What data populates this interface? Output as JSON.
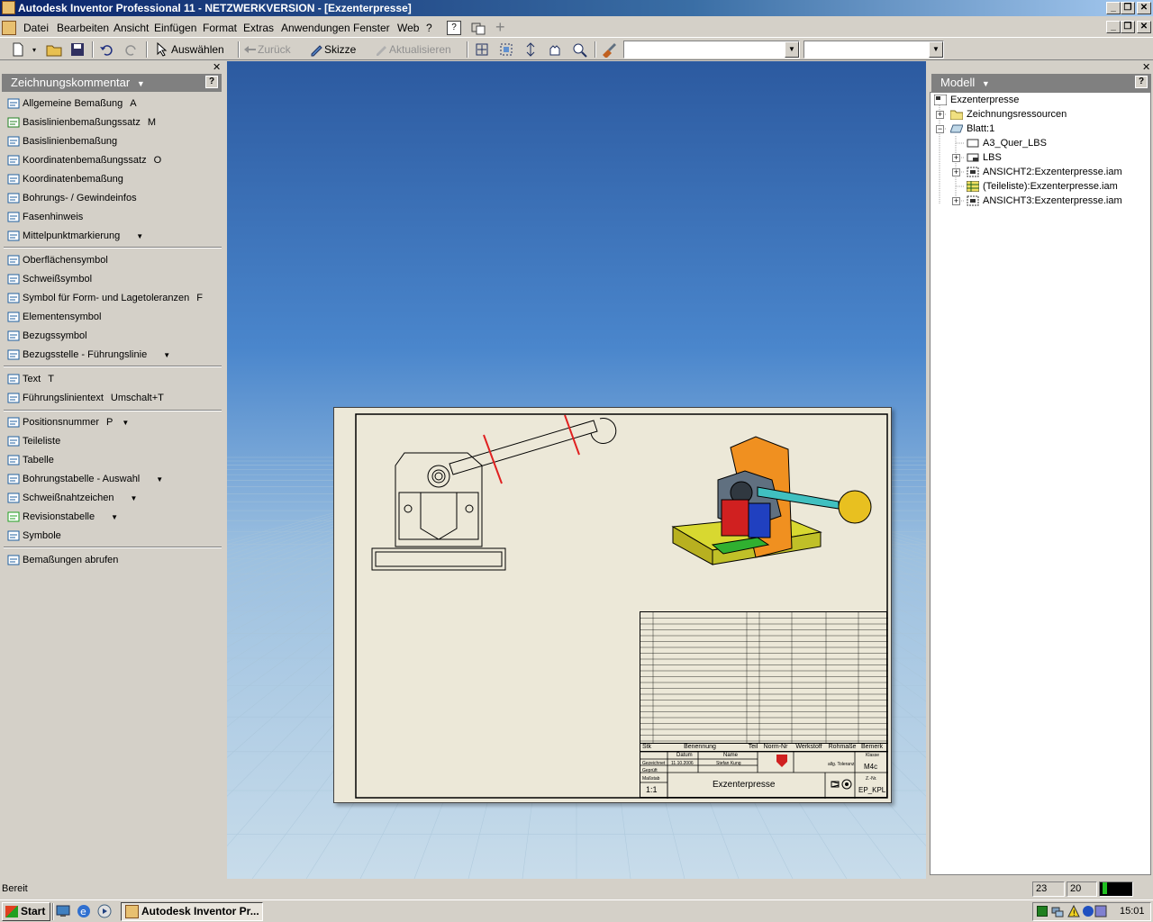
{
  "window": {
    "title": "Autodesk Inventor Professional 11 - NETZWERKVERSION - [Exzenterpresse]"
  },
  "menu": [
    "Datei",
    "Bearbeiten",
    "Ansicht",
    "Einfügen",
    "Format",
    "Extras",
    "Anwendungen",
    "Fenster",
    "Web",
    "?"
  ],
  "toolbar": {
    "select_label": "Auswählen",
    "back_label": "Zurück",
    "sketch_label": "Skizze",
    "update_label": "Aktualisieren"
  },
  "left_panel": {
    "title": "Zeichnungskommentar",
    "items": [
      {
        "label": "Allgemeine Bemaßung",
        "shortcut": "A"
      },
      {
        "label": "Basislinienbemaßungssatz",
        "shortcut": "M"
      },
      {
        "label": "Basislinienbemaßung",
        "shortcut": ""
      },
      {
        "label": "Koordinatenbemaßungssatz",
        "shortcut": "O"
      },
      {
        "label": "Koordinatenbemaßung",
        "shortcut": ""
      },
      {
        "label": "Bohrungs- / Gewindeinfos",
        "shortcut": ""
      },
      {
        "label": "Fasenhinweis",
        "shortcut": ""
      },
      {
        "label": "Mittelpunktmarkierung",
        "shortcut": ""
      },
      {
        "label": "Oberflächensymbol",
        "shortcut": ""
      },
      {
        "label": "Schweißsymbol",
        "shortcut": ""
      },
      {
        "label": "Symbol für Form- und Lagetoleranzen",
        "shortcut": "F"
      },
      {
        "label": "Elementensymbol",
        "shortcut": ""
      },
      {
        "label": "Bezugssymbol",
        "shortcut": ""
      },
      {
        "label": "Bezugsstelle - Führungslinie",
        "shortcut": ""
      },
      {
        "label": "Text",
        "shortcut": "T"
      },
      {
        "label": "Führungslinientext",
        "shortcut": "Umschalt+T"
      },
      {
        "label": "Positionsnummer",
        "shortcut": "P"
      },
      {
        "label": "Teileliste",
        "shortcut": ""
      },
      {
        "label": "Tabelle",
        "shortcut": ""
      },
      {
        "label": "Bohrungstabelle - Auswahl",
        "shortcut": ""
      },
      {
        "label": "Schweißnahtzeichen",
        "shortcut": ""
      },
      {
        "label": "Revisionstabelle",
        "shortcut": ""
      },
      {
        "label": "Symbole",
        "shortcut": ""
      },
      {
        "label": "Bemaßungen abrufen",
        "shortcut": ""
      }
    ]
  },
  "right_panel": {
    "title": "Modell",
    "tree": [
      "Exzenterpresse",
      "Zeichnungsressourcen",
      "Blatt:1",
      "A3_Quer_LBS",
      "LBS",
      "ANSICHT2:Exzenterpresse.iam",
      "(Teileliste):Exzenterpresse.iam",
      "ANSICHT3:Exzenterpresse.iam"
    ]
  },
  "drawing": {
    "title_block": {
      "headers": [
        "Stk",
        "Benennung",
        "Teil",
        "Norm-Nr",
        "Werkstoff",
        "Rohmaße",
        "Bemerk"
      ],
      "date_label": "Datum",
      "name_label": "Name",
      "drawn_label": "Gezeichnet",
      "checked_label": "Geprüft",
      "date": "11.10.2006",
      "name": "Stefan Kung",
      "tolerance": "allg. Toleranz",
      "scale_label": "Maßstab",
      "scale": "1:1",
      "drawing_title": "Exzenterpresse",
      "class_label": "Klasse",
      "class": "M4c",
      "number_label": "Z.-Nr.",
      "number": "EP_KPL"
    }
  },
  "statusbar": {
    "text": "Bereit",
    "field1": "23",
    "field2": "20"
  },
  "taskbar": {
    "start": "Start",
    "task": "Autodesk Inventor Pr...",
    "clock": "15:01"
  }
}
